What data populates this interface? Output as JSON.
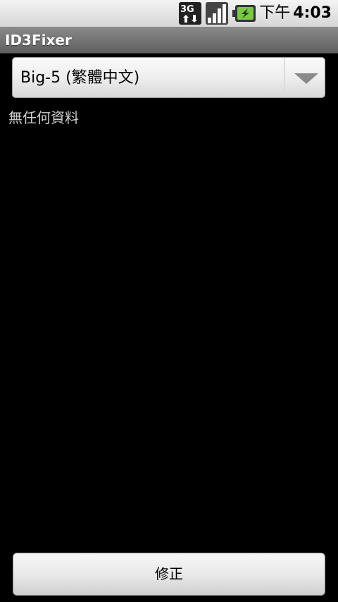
{
  "status_bar": {
    "network_label": "3G",
    "network_icon": "3g-data-icon",
    "signal_icon": "signal-strength-icon",
    "battery_icon": "battery-charging-icon",
    "time_period": "下午",
    "time": "4:03"
  },
  "app": {
    "title": "ID3Fixer"
  },
  "encoding_spinner": {
    "selected": "Big-5 (繁體中文)",
    "icon": "dropdown-arrow-icon"
  },
  "list": {
    "empty_text": "無任何資料"
  },
  "actions": {
    "fix_label": "修正"
  },
  "colors": {
    "background": "#000000",
    "status_bar": "#e0e0e0",
    "title_bar": "#707070",
    "battery_accent": "#7ac943"
  }
}
